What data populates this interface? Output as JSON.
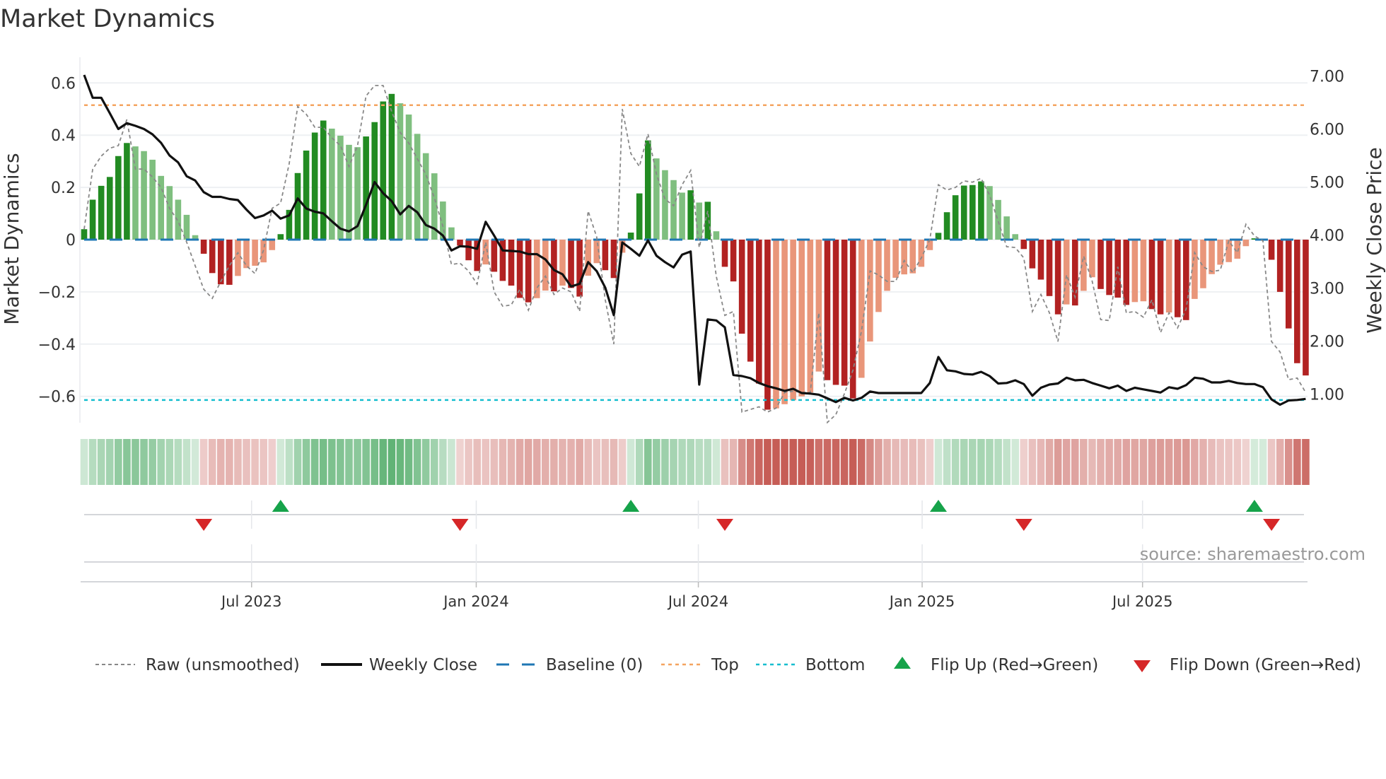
{
  "title": "Market Dynamics",
  "source": "source: sharemaestro.com",
  "colors": {
    "dark_green": "#228b22",
    "light_green": "#7fbf7f",
    "dark_red": "#b22222",
    "light_red": "#e9967a",
    "strip_green": "#2e9b4a",
    "strip_red": "#b8342c",
    "raw": "#888888",
    "close": "#111111",
    "baseline": "#1f77b4",
    "top": "#f4a460",
    "bottom": "#17becf",
    "flip_up": "#16a34a",
    "flip_down": "#d62728"
  },
  "chart_data": {
    "type": "bar",
    "title": "Market Dynamics",
    "ylabel": "Market Dynamics",
    "y2label": "Weekly Close Price",
    "ylim": [
      -0.7,
      0.7
    ],
    "y2lim": [
      0.35,
      7.7
    ],
    "y_ticks": [
      {
        "v": 0.6,
        "label": "0.6"
      },
      {
        "v": 0.4,
        "label": "0.4"
      },
      {
        "v": 0.2,
        "label": "0.2"
      },
      {
        "v": 0,
        "label": "0"
      },
      {
        "v": -0.2,
        "label": "−0.2"
      },
      {
        "v": -0.4,
        "label": "−0.4"
      },
      {
        "v": -0.6,
        "label": "−0.6"
      }
    ],
    "y2_ticks": [
      {
        "v": 7,
        "label": "7.00"
      },
      {
        "v": 6,
        "label": "6.00"
      },
      {
        "v": 5,
        "label": "5.00"
      },
      {
        "v": 4,
        "label": "4.00"
      },
      {
        "v": 3,
        "label": "3.00"
      },
      {
        "v": 2,
        "label": "2.00"
      },
      {
        "v": 1,
        "label": "1.00"
      }
    ],
    "x_ticks": [
      {
        "week": 20.6,
        "label": "Jul 2023"
      },
      {
        "week": 46.9,
        "label": "Jan 2024"
      },
      {
        "week": 72.9,
        "label": "Jul 2024"
      },
      {
        "week": 99.1,
        "label": "Jan 2025"
      },
      {
        "week": 124.9,
        "label": "Jul 2025"
      }
    ],
    "top_level": 0.515,
    "bottom_level": -0.614,
    "baseline_level": 0,
    "market_dynamics": [
      0.04,
      0.153,
      0.206,
      0.24,
      0.32,
      0.37,
      0.357,
      0.339,
      0.306,
      0.244,
      0.205,
      0.153,
      0.095,
      0.017,
      -0.054,
      -0.128,
      -0.171,
      -0.173,
      -0.139,
      -0.109,
      -0.1,
      -0.087,
      -0.04,
      0.021,
      0.114,
      0.255,
      0.341,
      0.41,
      0.456,
      0.425,
      0.398,
      0.363,
      0.354,
      0.395,
      0.45,
      0.529,
      0.558,
      0.522,
      0.479,
      0.405,
      0.331,
      0.254,
      0.146,
      0.047,
      -0.023,
      -0.079,
      -0.12,
      -0.095,
      -0.123,
      -0.158,
      -0.176,
      -0.223,
      -0.24,
      -0.224,
      -0.195,
      -0.198,
      -0.176,
      -0.185,
      -0.218,
      -0.138,
      -0.09,
      -0.117,
      -0.147,
      -0.05,
      0.027,
      0.177,
      0.38,
      0.311,
      0.266,
      0.228,
      0.18,
      0.189,
      0.142,
      0.145,
      0.032,
      -0.104,
      -0.16,
      -0.36,
      -0.467,
      -0.551,
      -0.651,
      -0.646,
      -0.63,
      -0.615,
      -0.6,
      -0.585,
      -0.505,
      -0.538,
      -0.556,
      -0.559,
      -0.608,
      -0.529,
      -0.39,
      -0.277,
      -0.196,
      -0.146,
      -0.133,
      -0.129,
      -0.104,
      -0.04,
      0.026,
      0.105,
      0.17,
      0.207,
      0.209,
      0.223,
      0.205,
      0.152,
      0.089,
      0.021,
      -0.036,
      -0.11,
      -0.153,
      -0.216,
      -0.286,
      -0.248,
      -0.252,
      -0.196,
      -0.144,
      -0.189,
      -0.212,
      -0.222,
      -0.25,
      -0.239,
      -0.236,
      -0.266,
      -0.286,
      -0.279,
      -0.297,
      -0.308,
      -0.227,
      -0.186,
      -0.132,
      -0.096,
      -0.086,
      -0.073,
      -0.025,
      0.005,
      0.003,
      -0.077,
      -0.2,
      -0.34,
      -0.473,
      -0.52
    ],
    "raw_unsmoothed": [
      0.04,
      0.27,
      0.32,
      0.35,
      0.36,
      0.46,
      0.27,
      0.27,
      0.24,
      0.2,
      0.12,
      0.07,
      -0.01,
      -0.1,
      -0.19,
      -0.225,
      -0.16,
      -0.1,
      -0.05,
      -0.1,
      -0.13,
      -0.04,
      0.12,
      0.14,
      0.29,
      0.51,
      0.48,
      0.43,
      0.43,
      0.39,
      0.36,
      0.28,
      0.36,
      0.55,
      0.59,
      0.59,
      0.49,
      0.41,
      0.37,
      0.31,
      0.25,
      0.16,
      0.05,
      -0.095,
      -0.09,
      -0.12,
      -0.17,
      -0.01,
      -0.2,
      -0.255,
      -0.25,
      -0.19,
      -0.27,
      -0.185,
      -0.14,
      -0.21,
      -0.185,
      -0.2,
      -0.275,
      0.11,
      0.01,
      -0.23,
      -0.4,
      0.5,
      0.33,
      0.28,
      0.405,
      0.25,
      0.155,
      0.13,
      0.21,
      0.265,
      -0.03,
      0.11,
      -0.14,
      -0.29,
      -0.275,
      -0.66,
      -0.65,
      -0.64,
      -0.66,
      -0.645,
      -0.585,
      -0.58,
      -0.585,
      -0.585,
      -0.28,
      -0.7,
      -0.67,
      -0.59,
      -0.5,
      -0.35,
      -0.12,
      -0.135,
      -0.16,
      -0.16,
      -0.08,
      -0.126,
      -0.07,
      0,
      0.21,
      0.19,
      0.2,
      0.225,
      0.22,
      0.235,
      0.17,
      0.07,
      -0.027,
      -0.03,
      -0.07,
      -0.275,
      -0.21,
      -0.28,
      -0.39,
      -0.135,
      -0.22,
      -0.063,
      -0.158,
      -0.306,
      -0.31,
      -0.104,
      -0.28,
      -0.275,
      -0.297,
      -0.23,
      -0.356,
      -0.28,
      -0.338,
      -0.266,
      -0.05,
      -0.104,
      -0.122,
      -0.117,
      -0.005,
      -0.05,
      0.059,
      0.014,
      -0.005,
      -0.39,
      -0.43,
      -0.536,
      -0.53,
      -0.585
    ],
    "weekly_close": [
      7.02,
      6.59,
      6.59,
      6.3,
      6.0,
      6.11,
      6.06,
      6.0,
      5.9,
      5.74,
      5.5,
      5.37,
      5.11,
      5.03,
      4.81,
      4.72,
      4.72,
      4.68,
      4.66,
      4.48,
      4.32,
      4.37,
      4.46,
      4.31,
      4.37,
      4.69,
      4.5,
      4.44,
      4.41,
      4.26,
      4.12,
      4.07,
      4.17,
      4.57,
      5.0,
      4.79,
      4.64,
      4.39,
      4.55,
      4.43,
      4.19,
      4.12,
      3.99,
      3.71,
      3.79,
      3.78,
      3.74,
      4.25,
      3.99,
      3.71,
      3.7,
      3.69,
      3.64,
      3.64,
      3.54,
      3.34,
      3.26,
      3.03,
      3.08,
      3.49,
      3.32,
      3.01,
      2.49,
      3.86,
      3.74,
      3.61,
      3.9,
      3.61,
      3.49,
      3.39,
      3.63,
      3.69,
      1.18,
      2.41,
      2.39,
      2.26,
      1.36,
      1.34,
      1.3,
      1.21,
      1.15,
      1.11,
      1.06,
      1.1,
      1.02,
      1.01,
      0.99,
      0.92,
      0.85,
      0.93,
      0.88,
      0.93,
      1.05,
      1.02,
      1.02,
      1.02,
      1.02,
      1.02,
      1.02,
      1.21,
      1.7,
      1.45,
      1.43,
      1.38,
      1.37,
      1.42,
      1.34,
      1.2,
      1.21,
      1.26,
      1.19,
      0.97,
      1.12,
      1.18,
      1.2,
      1.31,
      1.26,
      1.27,
      1.21,
      1.16,
      1.11,
      1.16,
      1.06,
      1.12,
      1.09,
      1.06,
      1.03,
      1.13,
      1.1,
      1.17,
      1.31,
      1.29,
      1.22,
      1.22,
      1.25,
      1.21,
      1.19,
      1.19,
      1.13,
      0.9,
      0.8,
      0.88,
      0.89,
      0.91
    ],
    "flip_up_weeks": [
      24,
      65,
      101,
      138
    ],
    "flip_down_weeks": [
      15,
      45,
      76,
      111,
      140
    ],
    "legend": {
      "placement": "bottom",
      "raw": "Raw (unsmoothed)",
      "close": "Weekly Close",
      "baseline": "Baseline (0)",
      "top": "Top",
      "bottom": "Bottom",
      "flip_up": "Flip Up (Red→Green)",
      "flip_down": "Flip Down (Green→Red)"
    }
  }
}
